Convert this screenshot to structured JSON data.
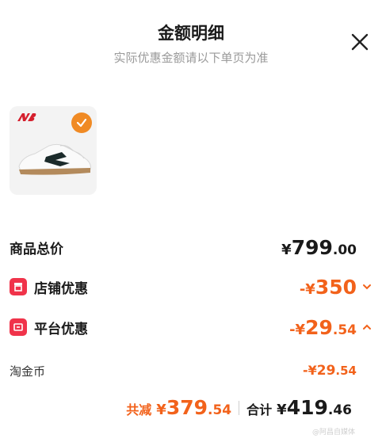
{
  "header": {
    "title": "金额明细",
    "subtitle": "实际优惠金额请以下单页为准"
  },
  "product": {
    "brand_icon": "new-balance-logo",
    "selected": true
  },
  "rows": {
    "total": {
      "label": "商品总价",
      "symbol": "¥",
      "int": "799",
      "dec": ".00"
    },
    "store": {
      "label": "店铺优惠",
      "prefix": "-¥",
      "int": "350",
      "dec": "",
      "chevron": "down"
    },
    "platform": {
      "label": "平台优惠",
      "prefix": "-¥",
      "int": "29",
      "dec": ".54",
      "chevron": "up"
    },
    "coin": {
      "label": "淘金币",
      "prefix": "-¥",
      "int": "29",
      "dec": ".54"
    }
  },
  "footer": {
    "saved_label": "共减",
    "saved_symbol": "¥",
    "saved_int": "379",
    "saved_dec": ".54",
    "total_label": "合计",
    "total_symbol": "¥",
    "total_int": "419",
    "total_dec": ".46"
  },
  "watermark": "@阿昌自媒体",
  "colors": {
    "accent": "#f2621b",
    "badge": "#f08a24",
    "coupon": "#f0334a"
  }
}
